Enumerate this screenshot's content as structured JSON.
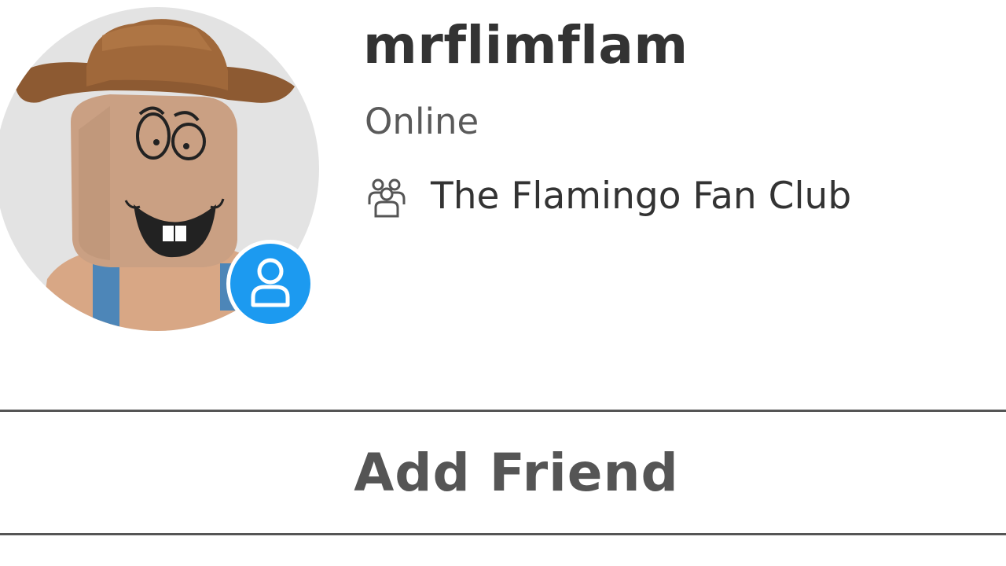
{
  "profile": {
    "username": "mrflimflam",
    "presence_status": "Online",
    "group_name": "The Flamingo Fan Club",
    "avatar_icon": "roblox-avatar",
    "status_icon": "user-icon",
    "group_icon": "group-icon"
  },
  "actions": {
    "add_friend_label": "Add Friend"
  },
  "colors": {
    "status_badge": "#1c9af0",
    "text_primary": "#333333",
    "text_secondary": "#5a5a5a",
    "button_border": "#555555"
  }
}
